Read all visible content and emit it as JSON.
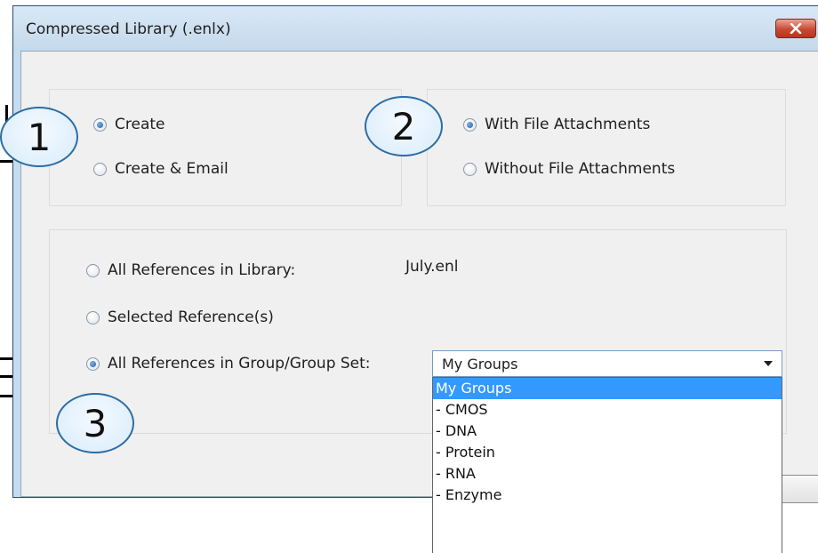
{
  "window": {
    "title": "Compressed Library (.enlx)"
  },
  "badges": [
    "1",
    "2",
    "3"
  ],
  "create_group": {
    "options": [
      {
        "label": "Create",
        "checked": true
      },
      {
        "label": "Create & Email",
        "checked": false
      }
    ]
  },
  "attachments_group": {
    "options": [
      {
        "label": "With File Attachments",
        "checked": true
      },
      {
        "label": "Without File Attachments",
        "checked": false
      }
    ]
  },
  "references_group": {
    "options": [
      {
        "label": "All References in Library:",
        "checked": false
      },
      {
        "label": "Selected Reference(s)",
        "checked": false
      },
      {
        "label": "All References in Group/Group Set:",
        "checked": true
      }
    ],
    "library_name": "July.enl",
    "group_select": {
      "value": "My Groups",
      "options": [
        "My Groups",
        "- CMOS",
        "- DNA",
        "- Protein",
        "- RNA",
        "- Enzyme"
      ]
    }
  },
  "colors": {
    "title_bar": "#c6dcef",
    "close_button": "#c84a34",
    "badge_border": "#2d6da3",
    "selection": "#3399ff"
  }
}
